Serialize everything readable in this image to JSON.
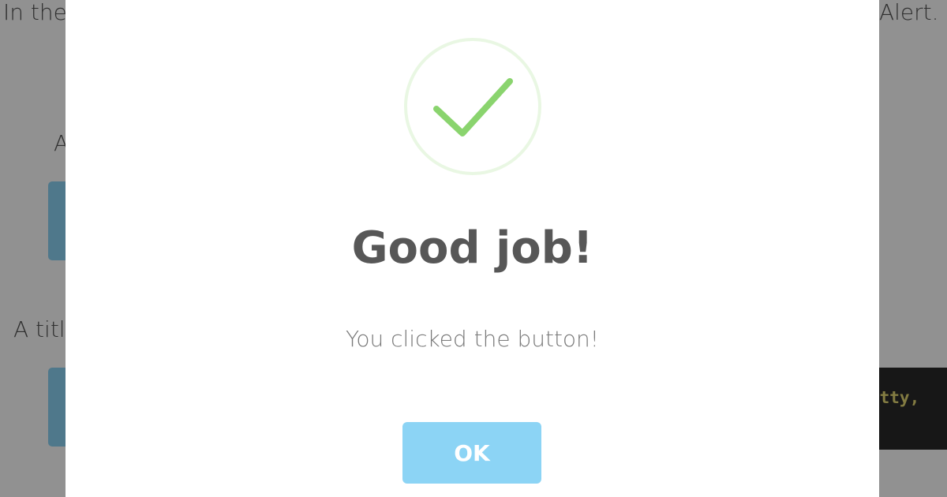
{
  "background": {
    "intro_left": "In the",
    "intro_right": "Alert.",
    "section_1_label": "A",
    "section_2_label": "A title",
    "code_snippet": "etty,"
  },
  "modal": {
    "icon": "checkmark-success-icon",
    "title": "Good job!",
    "text": "You clicked the button!",
    "confirm_label": "OK"
  },
  "colors": {
    "success_green": "#8ad46e",
    "success_ring": "#e9f7e3",
    "confirm_button": "#8cd4f5",
    "title_text": "#575757",
    "body_text": "#797979"
  }
}
